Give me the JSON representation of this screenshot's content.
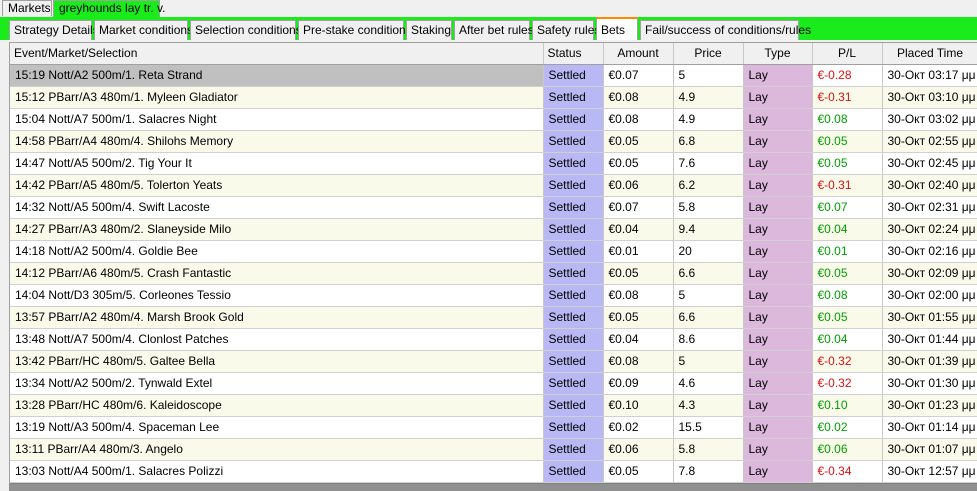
{
  "top_tabs": [
    {
      "label": "Markets"
    },
    {
      "label": "greyhounds lay tr. v."
    }
  ],
  "sub_tabs": [
    {
      "label": "Strategy Details"
    },
    {
      "label": "Market conditions"
    },
    {
      "label": "Selection conditions"
    },
    {
      "label": "Pre-stake conditions"
    },
    {
      "label": "Staking"
    },
    {
      "label": "After bet rules"
    },
    {
      "label": "Safety rules"
    },
    {
      "label": "Bets"
    },
    {
      "label": "Fail/success of conditions/rules"
    }
  ],
  "active_sub_tab": "Bets",
  "table": {
    "headers": {
      "event": "Event/Market/Selection",
      "status": "Status",
      "amount": "Amount",
      "price": "Price",
      "type": "Type",
      "pl": "P/L",
      "time": "Placed Time"
    },
    "rows": [
      {
        "event": "15:19 Nott/A2 500m/1. Reta Strand",
        "status": "Settled",
        "amount": "€0.07",
        "price": "5",
        "type": "Lay",
        "pl": "€-0.28",
        "pl_sign": "neg",
        "time": "30-Окт 03:17 μμ"
      },
      {
        "event": "15:12 PBarr/A3 480m/1. Myleen Gladiator",
        "status": "Settled",
        "amount": "€0.08",
        "price": "4.9",
        "type": "Lay",
        "pl": "€-0.31",
        "pl_sign": "neg",
        "time": "30-Окт 03:10 μμ"
      },
      {
        "event": "15:04 Nott/A7 500m/1. Salacres Night",
        "status": "Settled",
        "amount": "€0.08",
        "price": "4.9",
        "type": "Lay",
        "pl": "€0.08",
        "pl_sign": "pos",
        "time": "30-Окт 03:02 μμ"
      },
      {
        "event": "14:58 PBarr/A4 480m/4. Shilohs Memory",
        "status": "Settled",
        "amount": "€0.05",
        "price": "6.8",
        "type": "Lay",
        "pl": "€0.05",
        "pl_sign": "pos",
        "time": "30-Окт 02:55 μμ"
      },
      {
        "event": "14:47 Nott/A5 500m/2. Tig Your It",
        "status": "Settled",
        "amount": "€0.05",
        "price": "7.6",
        "type": "Lay",
        "pl": "€0.05",
        "pl_sign": "pos",
        "time": "30-Окт 02:45 μμ"
      },
      {
        "event": "14:42 PBarr/A5 480m/5. Tolerton Yeats",
        "status": "Settled",
        "amount": "€0.06",
        "price": "6.2",
        "type": "Lay",
        "pl": "€-0.31",
        "pl_sign": "neg",
        "time": "30-Окт 02:40 μμ"
      },
      {
        "event": "14:32 Nott/A5 500m/4. Swift Lacoste",
        "status": "Settled",
        "amount": "€0.07",
        "price": "5.8",
        "type": "Lay",
        "pl": "€0.07",
        "pl_sign": "pos",
        "time": "30-Окт 02:31 μμ"
      },
      {
        "event": "14:27 PBarr/A3 480m/2. Slaneyside Milo",
        "status": "Settled",
        "amount": "€0.04",
        "price": "9.4",
        "type": "Lay",
        "pl": "€0.04",
        "pl_sign": "pos",
        "time": "30-Окт 02:24 μμ"
      },
      {
        "event": "14:18 Nott/A2 500m/4. Goldie Bee",
        "status": "Settled",
        "amount": "€0.01",
        "price": "20",
        "type": "Lay",
        "pl": "€0.01",
        "pl_sign": "pos",
        "time": "30-Окт 02:16 μμ"
      },
      {
        "event": "14:12 PBarr/A6 480m/5. Crash Fantastic",
        "status": "Settled",
        "amount": "€0.05",
        "price": "6.6",
        "type": "Lay",
        "pl": "€0.05",
        "pl_sign": "pos",
        "time": "30-Окт 02:09 μμ"
      },
      {
        "event": "14:04 Nott/D3 305m/5. Corleones Tessio",
        "status": "Settled",
        "amount": "€0.08",
        "price": "5",
        "type": "Lay",
        "pl": "€0.08",
        "pl_sign": "pos",
        "time": "30-Окт 02:00 μμ"
      },
      {
        "event": "13:57 PBarr/A2 480m/4. Marsh Brook Gold",
        "status": "Settled",
        "amount": "€0.05",
        "price": "6.6",
        "type": "Lay",
        "pl": "€0.05",
        "pl_sign": "pos",
        "time": "30-Окт 01:55 μμ"
      },
      {
        "event": "13:48 Nott/A7 500m/4. Clonlost Patches",
        "status": "Settled",
        "amount": "€0.04",
        "price": "8.6",
        "type": "Lay",
        "pl": "€0.04",
        "pl_sign": "pos",
        "time": "30-Окт 01:44 μμ"
      },
      {
        "event": "13:42 PBarr/HC 480m/5. Galtee Bella",
        "status": "Settled",
        "amount": "€0.08",
        "price": "5",
        "type": "Lay",
        "pl": "€-0.32",
        "pl_sign": "neg",
        "time": "30-Окт 01:39 μμ"
      },
      {
        "event": "13:34 Nott/A2 500m/2. Tynwald Extel",
        "status": "Settled",
        "amount": "€0.09",
        "price": "4.6",
        "type": "Lay",
        "pl": "€-0.32",
        "pl_sign": "neg",
        "time": "30-Окт 01:30 μμ"
      },
      {
        "event": "13:28 PBarr/HC 480m/6. Kaleidoscope",
        "status": "Settled",
        "amount": "€0.10",
        "price": "4.3",
        "type": "Lay",
        "pl": "€0.10",
        "pl_sign": "pos",
        "time": "30-Окт 01:23 μμ"
      },
      {
        "event": "13:19 Nott/A3 500m/4. Spaceman Lee",
        "status": "Settled",
        "amount": "€0.02",
        "price": "15.5",
        "type": "Lay",
        "pl": "€0.02",
        "pl_sign": "pos",
        "time": "30-Окт 01:14 μμ"
      },
      {
        "event": "13:11 PBarr/A4 480m/3. Angelo",
        "status": "Settled",
        "amount": "€0.06",
        "price": "5.8",
        "type": "Lay",
        "pl": "€0.06",
        "pl_sign": "pos",
        "time": "30-Окт 01:07 μμ"
      },
      {
        "event": "13:03 Nott/A4 500m/1. Salacres Polizzi",
        "status": "Settled",
        "amount": "€0.05",
        "price": "7.8",
        "type": "Lay",
        "pl": "€-0.34",
        "pl_sign": "neg",
        "time": "30-Окт 12:57 μμ"
      }
    ]
  },
  "colors": {
    "accent_green": "#1aeb1a",
    "status_cell": "#b8b8f5",
    "type_cell": "#dcb8dc",
    "negative": "#e01010",
    "positive": "#00a000",
    "active_tab_marker": "#ff8c00"
  }
}
